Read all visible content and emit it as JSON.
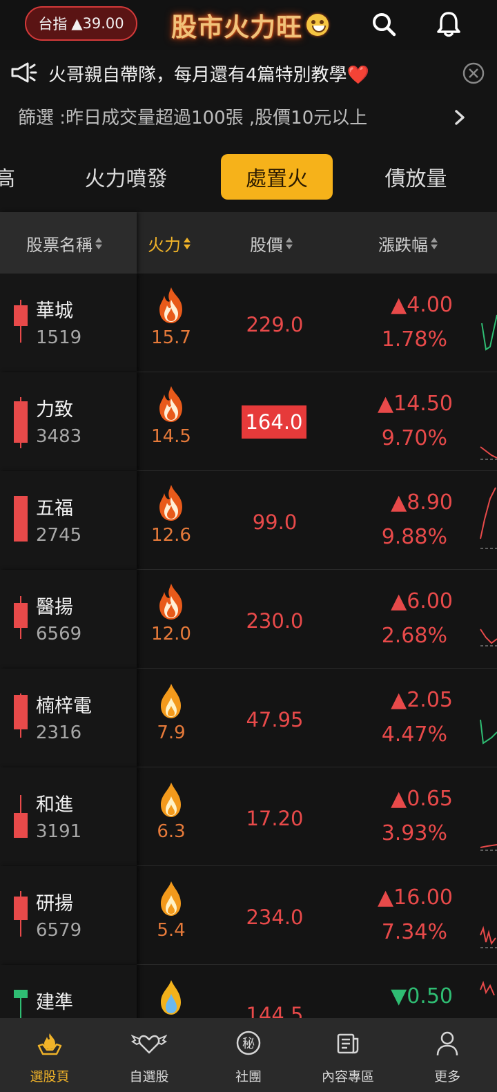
{
  "header": {
    "index_label": "台指",
    "index_change": "▲39.00",
    "logo_text": "股市火力旺"
  },
  "announcement": {
    "text": "火哥親自帶隊，每月還有4篇特別教學❤️"
  },
  "filter": {
    "text": "篩選 :昨日成交量超過100張 ,股價10元以上"
  },
  "tabs": [
    {
      "label": "高"
    },
    {
      "label": "火力噴發"
    },
    {
      "label": "處置火",
      "active": true
    },
    {
      "label": "債放量"
    }
  ],
  "table": {
    "headers": {
      "name": "股票名稱",
      "power": "火力",
      "price": "股價",
      "change": "漲跌幅"
    },
    "rows": [
      {
        "name": "華城",
        "code": "1519",
        "power": "15.7",
        "price": "229.0",
        "change": "▲4.00",
        "pct": "1.78%",
        "direction": "up"
      },
      {
        "name": "力致",
        "code": "3483",
        "power": "14.5",
        "price": "164.0",
        "change": "▲14.50",
        "pct": "9.70%",
        "direction": "up",
        "price_highlight": true
      },
      {
        "name": "五福",
        "code": "2745",
        "power": "12.6",
        "price": "99.0",
        "change": "▲8.90",
        "pct": "9.88%",
        "direction": "up"
      },
      {
        "name": "醫揚",
        "code": "6569",
        "power": "12.0",
        "price": "230.0",
        "change": "▲6.00",
        "pct": "2.68%",
        "direction": "up"
      },
      {
        "name": "楠梓電",
        "code": "2316",
        "power": "7.9",
        "price": "47.95",
        "change": "▲2.05",
        "pct": "4.47%",
        "direction": "up"
      },
      {
        "name": "和進",
        "code": "3191",
        "power": "6.3",
        "price": "17.20",
        "change": "▲0.65",
        "pct": "3.93%",
        "direction": "up"
      },
      {
        "name": "研揚",
        "code": "6579",
        "power": "5.4",
        "price": "234.0",
        "change": "▲16.00",
        "pct": "7.34%",
        "direction": "up"
      },
      {
        "name": "建準",
        "code": "",
        "power": "",
        "price": "144.5",
        "change": "▼0.50",
        "pct": "",
        "direction": "down"
      }
    ]
  },
  "bottom_nav": [
    {
      "label": "選股頁",
      "icon": "stock-pick-icon",
      "active": true
    },
    {
      "label": "自選股",
      "icon": "heart-wings-icon"
    },
    {
      "label": "社團",
      "icon": "secret-icon"
    },
    {
      "label": "內容專區",
      "icon": "newspaper-icon"
    },
    {
      "label": "更多",
      "icon": "user-icon"
    }
  ],
  "colors": {
    "up": "#e84a4a",
    "down": "#2fbd73",
    "accent": "#f6b21a",
    "background": "#141414"
  }
}
